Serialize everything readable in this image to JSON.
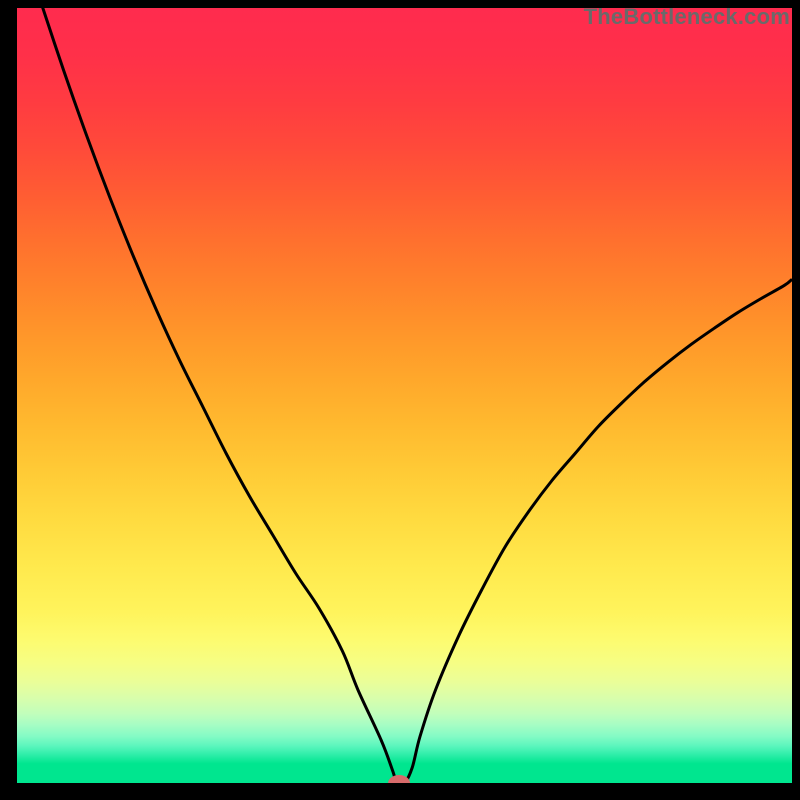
{
  "watermark": "TheBottleneck.com",
  "chart_data": {
    "type": "line",
    "title": "",
    "xlabel": "",
    "ylabel": "",
    "xlim": [
      0,
      100
    ],
    "ylim": [
      0,
      100
    ],
    "x": [
      3,
      6,
      9,
      12,
      15,
      18,
      21,
      24,
      27,
      30,
      33,
      36,
      39,
      42,
      44,
      47,
      48.5,
      49,
      50,
      51,
      52,
      54,
      57,
      60,
      63,
      66,
      69,
      72,
      75,
      78,
      81,
      84,
      87,
      90,
      93,
      96,
      99,
      100
    ],
    "values": [
      101,
      92,
      83.5,
      75.5,
      68,
      61,
      54.5,
      48.5,
      42.5,
      37,
      32,
      27,
      22.5,
      17,
      12,
      5.5,
      1.5,
      0,
      0,
      2,
      6,
      12,
      19,
      25,
      30.5,
      35,
      39,
      42.5,
      46,
      49,
      51.8,
      54.3,
      56.6,
      58.7,
      60.7,
      62.5,
      64.2,
      65
    ],
    "marker": {
      "x": 49.3,
      "y": 0,
      "color": "#d76b6b"
    },
    "gradient_stops": [
      {
        "offset": 0.0,
        "color": "#ff2b4e"
      },
      {
        "offset": 0.06,
        "color": "#ff3049"
      },
      {
        "offset": 0.12,
        "color": "#ff3b41"
      },
      {
        "offset": 0.18,
        "color": "#ff4a3a"
      },
      {
        "offset": 0.24,
        "color": "#ff5c33"
      },
      {
        "offset": 0.3,
        "color": "#ff702e"
      },
      {
        "offset": 0.36,
        "color": "#ff832b"
      },
      {
        "offset": 0.42,
        "color": "#ff962a"
      },
      {
        "offset": 0.48,
        "color": "#ffa82b"
      },
      {
        "offset": 0.54,
        "color": "#ffba2f"
      },
      {
        "offset": 0.6,
        "color": "#ffcb36"
      },
      {
        "offset": 0.66,
        "color": "#ffdb40"
      },
      {
        "offset": 0.72,
        "color": "#ffe94d"
      },
      {
        "offset": 0.78,
        "color": "#fff45c"
      },
      {
        "offset": 0.815,
        "color": "#fdfb6f"
      },
      {
        "offset": 0.845,
        "color": "#f6fe84"
      },
      {
        "offset": 0.87,
        "color": "#eafe99"
      },
      {
        "offset": 0.89,
        "color": "#d9feab"
      },
      {
        "offset": 0.91,
        "color": "#c2febb"
      },
      {
        "offset": 0.925,
        "color": "#a6fdc4"
      },
      {
        "offset": 0.94,
        "color": "#83fbc5"
      },
      {
        "offset": 0.952,
        "color": "#5cf6bd"
      },
      {
        "offset": 0.962,
        "color": "#34efac"
      },
      {
        "offset": 0.975,
        "color": "#00e68f"
      },
      {
        "offset": 1.0,
        "color": "#00e68f"
      }
    ],
    "frame_color": "#000000",
    "curve_color": "#000000",
    "plot_inset": {
      "left": 17,
      "right": 8,
      "top": 8,
      "bottom": 17
    }
  }
}
